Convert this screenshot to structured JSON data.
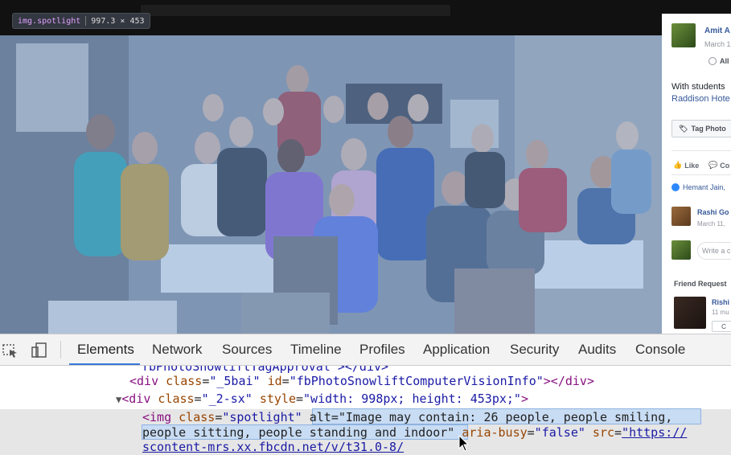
{
  "tooltip": {
    "tag": "img.spotlight",
    "dims": "997.3 × 453"
  },
  "side_panel": {
    "poster_name": "Amit A",
    "poster_date": "March 1",
    "audience": "All",
    "caption_line1": "With students",
    "caption_line2": "Raddison Hote",
    "tag_photo": "Tag Photo",
    "like": "Like",
    "comment": "Co",
    "likers": "Hemant Jain,",
    "commenter_name": "Rashi Go",
    "commenter_date": "March 11,",
    "write_comment": "Write a c",
    "friend_requests": "Friend Request",
    "request_name": "Rishi",
    "request_mutual": "11 mu",
    "confirm": "C"
  },
  "devtools": {
    "tabs": [
      "Elements",
      "Network",
      "Sources",
      "Timeline",
      "Profiles",
      "Application",
      "Security",
      "Audits",
      "Console"
    ],
    "active_tab": "Elements"
  },
  "dom": {
    "line0": "fbPhotoSnowliftTagApproval\"></div>",
    "line1": {
      "open": "<div ",
      "attr1": "class",
      "val1": "\"_5bai\"",
      "attr2": "id",
      "val2": "\"fbPhotoSnowliftComputerVisionInfo\"",
      "close": "></div>"
    },
    "line2": {
      "open": "<div ",
      "attr1": "class",
      "val1": "\"_2-sx\"",
      "attr2": "style",
      "val2": "\"width: 998px; height: 453px;\"",
      "close": ">"
    },
    "line3": {
      "open": "<img ",
      "attr1": "class",
      "val1": "\"spotlight\"",
      "alt_attr": "alt",
      "alt_val_part1": "\"Image may contain: 26 people, people smiling,",
      "alt_val_part2": "people sitting, people standing and indoor\"",
      "attr3": "aria-busy",
      "val3": "\"false\"",
      "attr4": "src",
      "val4": "\"https://",
      "url_cont": "scontent-mrs.xx.fbcdn.net/v/t31.0-8/"
    }
  }
}
